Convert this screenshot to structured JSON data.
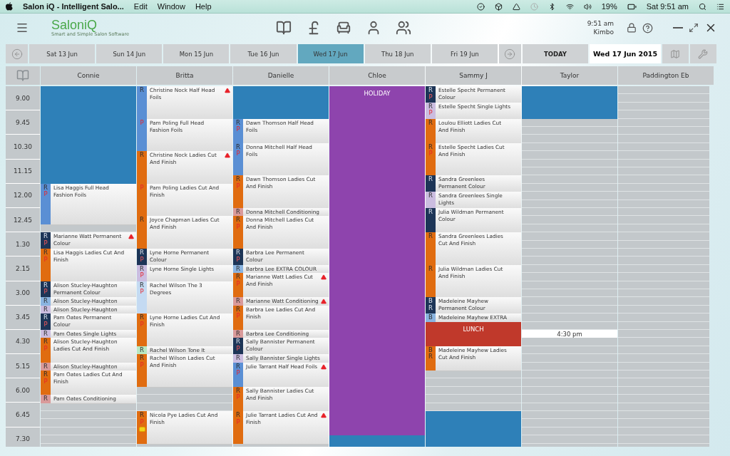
{
  "menu_bar": {
    "app_title": "Salon iQ - Intelligent Salo...",
    "menus": [
      "Edit",
      "Window",
      "Help"
    ],
    "battery": "19%",
    "clock": "Sat 9:51 am"
  },
  "header": {
    "logo": "SaloniQ",
    "tagline": "Smart and Simple Salon Software",
    "time": "9:51 am",
    "user": "Kimbo"
  },
  "dates": [
    {
      "label": "Sat 13 Jun",
      "selected": false
    },
    {
      "label": "Sun 14 Jun",
      "selected": false
    },
    {
      "label": "Mon 15 Jun",
      "selected": false
    },
    {
      "label": "Tue 16 Jun",
      "selected": false
    },
    {
      "label": "Wed 17 Jun",
      "selected": true
    },
    {
      "label": "Thu 18 Jun",
      "selected": false
    },
    {
      "label": "Fri 19 Jun",
      "selected": false
    }
  ],
  "today_button": "TODAY",
  "current_date": "Wed 17 Jun 2015",
  "times": [
    "9.00",
    "9.45",
    "10.30",
    "11.15",
    "12.00",
    "12.45",
    "1.30",
    "2.15",
    "3.00",
    "3.45",
    "4.30",
    "5.15",
    "6.00",
    "6.45",
    "7.30"
  ],
  "columns": [
    {
      "name": "Connie",
      "items": [
        {
          "kind": "blocked"
        },
        {
          "kind": "appointment",
          "codes": [
            "R",
            "P"
          ],
          "color": "#5a8fd4",
          "text": "Lisa Haggis  Full Head Fashion Foils",
          "warning": false
        },
        {
          "kind": "appointment",
          "codes": [
            "R",
            "P"
          ],
          "color": "#1d3557",
          "text": "Marianne Watt  Permanent Colour",
          "warning": true
        },
        {
          "kind": "appointment",
          "codes": [
            "R",
            "P"
          ],
          "color": "#e06c10",
          "text": "Lisa Haggis  Ladies Cut And Finish",
          "warning": false
        },
        {
          "kind": "appointment",
          "codes": [
            "R",
            "P"
          ],
          "color": "#1d3557",
          "text": "Alison Stucley-Haughton Permanent Colour",
          "warning": false
        },
        {
          "kind": "appointment",
          "codes": [
            "R"
          ],
          "color": "#8ab4e0",
          "text": "Alison Stucley-Haughton",
          "warning": false
        },
        {
          "kind": "appointment",
          "codes": [
            "R"
          ],
          "color": "#cbbde0",
          "text": "Alison Stucley-Haughton",
          "warning": false
        },
        {
          "kind": "appointment",
          "codes": [
            "R",
            "P"
          ],
          "color": "#1d3557",
          "text": "Pam Oates  Permanent Colour",
          "warning": false
        },
        {
          "kind": "appointment",
          "codes": [
            "R"
          ],
          "color": "#cbbde0",
          "text": "Pam Oates  Single Lights",
          "warning": false
        },
        {
          "kind": "appointment",
          "codes": [
            "R",
            "P"
          ],
          "color": "#e06c10",
          "text": "Alison Stucley-Haughton Ladies Cut And Finish",
          "warning": false
        },
        {
          "kind": "appointment",
          "codes": [
            "R"
          ],
          "color": "#d99a9a",
          "text": "Alison Stucley-Haughton",
          "warning": false
        },
        {
          "kind": "appointment",
          "codes": [
            "R",
            "P"
          ],
          "color": "#e06c10",
          "text": "Pam Oates  Ladies Cut And Finish",
          "warning": false
        },
        {
          "kind": "appointment",
          "codes": [
            "R"
          ],
          "color": "#d99a9a",
          "text": "Pam Oates  Conditioning",
          "warning": false
        }
      ]
    },
    {
      "name": "Britta",
      "items": [
        {
          "kind": "appointment",
          "codes": [
            "R"
          ],
          "color": "#5a8fd4",
          "text": "Christine Nock  Half Head Foils",
          "warning": true
        },
        {
          "kind": "appointment",
          "codes": [
            "P"
          ],
          "color": "#5a8fd4",
          "text": "Pam Poling  Full Head Fashion Foils",
          "warning": false
        },
        {
          "kind": "appointment",
          "codes": [
            "R"
          ],
          "color": "#e06c10",
          "text": "Christine Nock  Ladies Cut And Finish",
          "warning": true
        },
        {
          "kind": "appointment",
          "codes": [
            "P"
          ],
          "color": "#e06c10",
          "text": "Pam Poling  Ladies Cut And Finish",
          "warning": false
        },
        {
          "kind": "appointment",
          "codes": [
            "R"
          ],
          "color": "#e06c10",
          "text": "Joyce Chapman  Ladies Cut And Finish",
          "warning": false
        },
        {
          "kind": "appointment",
          "codes": [
            "R",
            "P"
          ],
          "color": "#1d3557",
          "text": "Lyne Horne  Permanent Colour",
          "warning": false
        },
        {
          "kind": "appointment",
          "codes": [
            "R",
            "P"
          ],
          "color": "#cbbde0",
          "text": "Lyne Horne  Single Lights",
          "warning": false
        },
        {
          "kind": "appointment",
          "codes": [
            "R",
            "P"
          ],
          "color": "#c4daf2",
          "text": "Rachel Wilson  The 3 Degrees",
          "warning": false
        },
        {
          "kind": "appointment",
          "codes": [
            "R",
            "P"
          ],
          "color": "#e06c10",
          "text": "Lyne Horne  Ladies Cut And Finish",
          "warning": false
        },
        {
          "kind": "appointment",
          "codes": [
            "R"
          ],
          "color": "#b9e8c2",
          "text": "Rachel Wilson  Tone It",
          "warning": false
        },
        {
          "kind": "appointment",
          "codes": [
            "R",
            "P"
          ],
          "color": "#e06c10",
          "text": "Rachel Wilson  Ladies Cut And Finish",
          "warning": false
        },
        {
          "kind": "appointment",
          "codes": [
            "R",
            "P"
          ],
          "color": "#e06c10",
          "text": "Nicola Pye  Ladies Cut And Finish",
          "warning": false,
          "flag": true
        }
      ]
    },
    {
      "name": "Danielle",
      "items": [
        {
          "kind": "blocked"
        },
        {
          "kind": "appointment",
          "codes": [
            "R",
            "P"
          ],
          "color": "#5a8fd4",
          "text": "Dawn Thomson  Half Head Foils",
          "warning": false
        },
        {
          "kind": "appointment",
          "codes": [
            "R",
            "P"
          ],
          "color": "#5a8fd4",
          "text": "Donna Mitchell  Half Head Foils",
          "warning": false
        },
        {
          "kind": "appointment",
          "codes": [
            "R",
            "P"
          ],
          "color": "#e06c10",
          "text": "Dawn Thomson  Ladies Cut And Finish",
          "warning": false
        },
        {
          "kind": "appointment",
          "codes": [
            "R"
          ],
          "color": "#d99a9a",
          "text": "Donna Mitchell  Conditioning",
          "warning": false
        },
        {
          "kind": "appointment",
          "codes": [
            "R",
            "P"
          ],
          "color": "#e06c10",
          "text": "Donna Mitchell  Ladies Cut And Finish",
          "warning": false
        },
        {
          "kind": "appointment",
          "codes": [
            "R",
            "P"
          ],
          "color": "#1d3557",
          "text": "Barbra Lee  Permanent Colour",
          "warning": false
        },
        {
          "kind": "appointment",
          "codes": [
            "R"
          ],
          "color": "#8ab4e0",
          "text": "Barbra Lee  EXTRA COLOUR",
          "warning": false
        },
        {
          "kind": "appointment",
          "codes": [
            "R",
            "P"
          ],
          "color": "#e06c10",
          "text": "Marianne Watt  Ladies Cut And Finish",
          "warning": true
        },
        {
          "kind": "appointment",
          "codes": [
            "R"
          ],
          "color": "#d99a9a",
          "text": "Marianne Watt  Conditioning",
          "warning": true
        },
        {
          "kind": "appointment",
          "codes": [
            "R",
            "P"
          ],
          "color": "#e06c10",
          "text": "Barbra Lee  Ladies Cut And Finish",
          "warning": false
        },
        {
          "kind": "appointment",
          "codes": [
            "R"
          ],
          "color": "#d99a9a",
          "text": "Barbra Lee  Conditioning",
          "warning": false
        },
        {
          "kind": "appointment",
          "codes": [
            "R",
            "P"
          ],
          "color": "#1d3557",
          "text": "Sally Bannister  Permanent Colour",
          "warning": false
        },
        {
          "kind": "appointment",
          "codes": [
            "R"
          ],
          "color": "#cbbde0",
          "text": "Sally Bannister  Single Lights",
          "warning": false
        },
        {
          "kind": "appointment",
          "codes": [
            "R",
            "P"
          ],
          "color": "#5a8fd4",
          "text": "Julie Tarrant  Half Head Foils",
          "warning": true
        },
        {
          "kind": "appointment",
          "codes": [
            "R",
            "P"
          ],
          "color": "#e06c10",
          "text": "Sally Bannister  Ladies Cut And Finish",
          "warning": false
        },
        {
          "kind": "appointment",
          "codes": [
            "R",
            "P"
          ],
          "color": "#e06c10",
          "text": "Julie Tarrant  Ladies Cut And Finish",
          "warning": true
        }
      ]
    },
    {
      "name": "Chloe",
      "items": [
        {
          "kind": "holiday",
          "label": "HOLIDAY"
        },
        {
          "kind": "blocked"
        }
      ]
    },
    {
      "name": "Sammy J",
      "items": [
        {
          "kind": "appointment",
          "codes": [
            "R",
            "P"
          ],
          "color": "#1d3557",
          "text": "Estelle Specht  Permanent Colour",
          "warning": false
        },
        {
          "kind": "appointment",
          "codes": [
            "R",
            "P"
          ],
          "color": "#cbbde0",
          "text": "Estelle Specht  Single Lights",
          "warning": false
        },
        {
          "kind": "appointment",
          "codes": [
            "R"
          ],
          "color": "#e06c10",
          "text": "Loulou Elliott  Ladies Cut And Finish",
          "warning": false
        },
        {
          "kind": "appointment",
          "codes": [
            "R",
            "P"
          ],
          "color": "#e06c10",
          "text": "Estelle Specht  Ladies Cut And Finish",
          "warning": false
        },
        {
          "kind": "appointment",
          "codes": [
            "R"
          ],
          "color": "#1d3557",
          "text": "Sandra Greenlees  Permanent Colour",
          "warning": false
        },
        {
          "kind": "appointment",
          "codes": [
            "R"
          ],
          "color": "#cbbde0",
          "text": "Sandra Greenlees  Single Lights",
          "warning": false
        },
        {
          "kind": "appointment",
          "codes": [
            "R"
          ],
          "color": "#1d3557",
          "text": "Julia Wildman  Permanent Colour",
          "warning": false
        },
        {
          "kind": "appointment",
          "codes": [
            "R"
          ],
          "color": "#e06c10",
          "text": "Sandra Greenlees  Ladies Cut And Finish",
          "warning": false
        },
        {
          "kind": "appointment",
          "codes": [
            "R"
          ],
          "color": "#e06c10",
          "text": "Julia Wildman  Ladies Cut And Finish",
          "warning": false
        },
        {
          "kind": "appointment",
          "codes": [
            "B",
            "R"
          ],
          "color": "#1d3557",
          "text": "Madeleine Mayhew  Permanent Colour",
          "warning": false
        },
        {
          "kind": "appointment",
          "codes": [
            "B"
          ],
          "color": "#8ab4e0",
          "text": "Madeleine Mayhew  EXTRA",
          "warning": false
        },
        {
          "kind": "lunch",
          "label": "LUNCH"
        },
        {
          "kind": "appointment",
          "codes": [
            "B",
            "R"
          ],
          "color": "#e06c10",
          "text": "Madeleine Mayhew  Ladies Cut And Finish",
          "warning": false
        },
        {
          "kind": "blocked"
        }
      ]
    },
    {
      "name": "Taylor",
      "items": [
        {
          "kind": "blocked"
        },
        {
          "kind": "marker",
          "label": "4:30 pm"
        }
      ]
    },
    {
      "name": "Paddington Eb"
    }
  ]
}
